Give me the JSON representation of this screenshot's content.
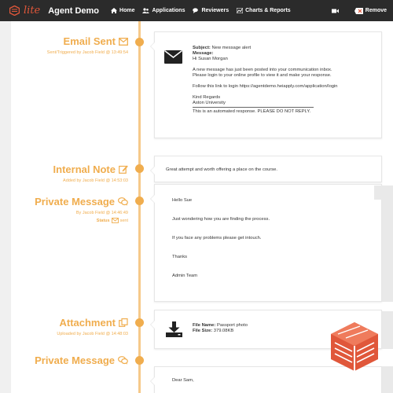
{
  "navbar": {
    "logo_text": "lite",
    "app_name": "Agent Demo",
    "items": [
      {
        "label": "Home",
        "icon": "home-icon"
      },
      {
        "label": "Applications",
        "icon": "users-icon"
      },
      {
        "label": "Reviewers",
        "icon": "comments-icon"
      },
      {
        "label": "Charts & Reports",
        "icon": "chart-icon"
      }
    ],
    "camera_icon": "video-camera-icon",
    "remove_label": "Remove",
    "colors": {
      "background": "#2b2b2b",
      "brand": "#e0573a"
    }
  },
  "timeline": {
    "accent_color": "#f0ad4e",
    "entries": [
      {
        "title": "Email Sent",
        "icon": "envelope-icon",
        "meta": "Sent/Triggered by Jacob Field @ 13:49:54",
        "subject_label": "Subject:",
        "subject": "New message alert",
        "message_label": "Message:",
        "lines": [
          "Hi Susan Morgan",
          "",
          "A new message has just been posted into your communication inbox.",
          "Please login to your online profile to view it and make your response.",
          "",
          "Follow this link to login https://agentdemo.heiapply.com/application/login",
          "",
          "Kind Regards",
          "Aston University"
        ],
        "footer": "This is an automated response. PLEASE DO NOT REPLY."
      },
      {
        "title": "Internal Note",
        "icon": "edit-icon",
        "meta": "Added by Jacob Field @ 14:53:03",
        "text": "Great attempt and worth offering a place on the course."
      },
      {
        "title": "Private Message",
        "icon": "chat-icon",
        "meta": "By Jacob Field @ 14:46:49",
        "status_label": "Status",
        "status_value": "sent",
        "lines": [
          "Hello Sue",
          "Just wondering how you are finding the process.",
          "If you face any problems please get intouch.",
          "Thanks",
          "Admin Team"
        ]
      },
      {
        "title": "Attachment",
        "icon": "files-icon",
        "meta": "Uploaded by Jacob Field @ 14:48:03",
        "file_name_label": "File Name:",
        "file_name": "Passport photo",
        "file_size_label": "File Size:",
        "file_size": "379.08KB"
      },
      {
        "title": "Private Message",
        "icon": "chat-icon",
        "text": "Dear Sam,"
      }
    ]
  }
}
